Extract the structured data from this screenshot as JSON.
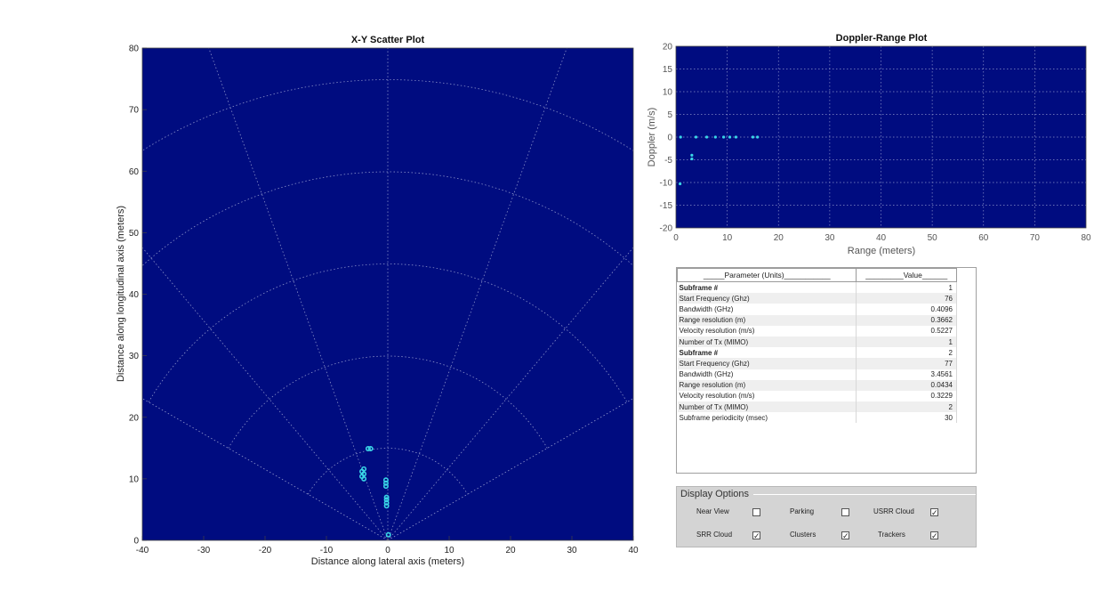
{
  "chart_data": [
    {
      "type": "scatter",
      "title": "X-Y Scatter Plot",
      "xlabel": "Distance along lateral axis (meters)",
      "ylabel": "Distance along longitudinal axis (meters)",
      "xlim": [
        -40,
        40
      ],
      "ylim": [
        0,
        80
      ],
      "xticks": [
        "-40",
        "-30",
        "-20",
        "-10",
        "0",
        "10",
        "20",
        "30",
        "40"
      ],
      "yticks": [
        "0",
        "10",
        "20",
        "30",
        "40",
        "50",
        "60",
        "70",
        "80"
      ],
      "polar_grid": true,
      "background_color": "#000c80",
      "marker_color": "#39d4e6",
      "points": [
        {
          "x": -3.2,
          "y": 14.9
        },
        {
          "x": -2.8,
          "y": 14.9
        },
        {
          "x": -3.9,
          "y": 10.0
        },
        {
          "x": -3.9,
          "y": 10.8
        },
        {
          "x": -3.9,
          "y": 11.6
        },
        {
          "x": -4.2,
          "y": 10.4
        },
        {
          "x": -4.2,
          "y": 11.2
        },
        {
          "x": -0.3,
          "y": 8.8
        },
        {
          "x": -0.3,
          "y": 9.3
        },
        {
          "x": -0.3,
          "y": 9.8
        },
        {
          "x": -0.2,
          "y": 5.6
        },
        {
          "x": -0.2,
          "y": 6.1
        },
        {
          "x": -0.2,
          "y": 6.6
        },
        {
          "x": -0.2,
          "y": 7.0
        },
        {
          "x": 0.1,
          "y": 0.9
        }
      ]
    },
    {
      "type": "scatter",
      "title": "Doppler-Range Plot",
      "xlabel": "Range (meters)",
      "ylabel": "Doppler (m/s)",
      "xlim": [
        0,
        80
      ],
      "ylim": [
        -20,
        20
      ],
      "xticks": [
        "0",
        "10",
        "20",
        "30",
        "40",
        "50",
        "60",
        "70",
        "80"
      ],
      "yticks": [
        "-20",
        "-15",
        "-10",
        "-5",
        "0",
        "5",
        "10",
        "15",
        "20"
      ],
      "grid": true,
      "background_color": "#000c80",
      "marker_color": "#39d4e6",
      "points": [
        {
          "x": 0.9,
          "y": 0
        },
        {
          "x": 3.9,
          "y": 0
        },
        {
          "x": 6.0,
          "y": 0
        },
        {
          "x": 7.7,
          "y": 0
        },
        {
          "x": 9.3,
          "y": 0
        },
        {
          "x": 10.5,
          "y": 0
        },
        {
          "x": 11.7,
          "y": 0
        },
        {
          "x": 15.0,
          "y": 0
        },
        {
          "x": 15.9,
          "y": 0
        },
        {
          "x": 3.1,
          "y": -4.0
        },
        {
          "x": 3.1,
          "y": -4.8
        },
        {
          "x": 0.8,
          "y": -10.3
        }
      ]
    }
  ],
  "parameters": {
    "header_param": "_____Parameter (Units)___________",
    "header_value": "_________Value______",
    "rows": [
      {
        "param": "Subframe #",
        "value": "1",
        "bold": true
      },
      {
        "param": "Start Frequency (Ghz)",
        "value": "76"
      },
      {
        "param": "Bandwidth (GHz)",
        "value": "0.4096"
      },
      {
        "param": "Range resolution (m)",
        "value": "0.3662"
      },
      {
        "param": "Velocity resolution (m/s)",
        "value": "0.5227"
      },
      {
        "param": "Number of Tx (MIMO)",
        "value": "1"
      },
      {
        "param": "Subframe #",
        "value": "2",
        "bold": true
      },
      {
        "param": "Start Frequency (Ghz)",
        "value": "77"
      },
      {
        "param": "Bandwidth (GHz)",
        "value": "3.4561"
      },
      {
        "param": "Range resolution (m)",
        "value": "0.0434"
      },
      {
        "param": "Velocity resolution (m/s)",
        "value": "0.3229"
      },
      {
        "param": "Number of Tx (MIMO)",
        "value": "2"
      },
      {
        "param": "Subframe periodicity (msec)",
        "value": "30"
      }
    ]
  },
  "display_options": {
    "title": "Display Options",
    "options": [
      {
        "label": "Near View",
        "checked": false
      },
      {
        "label": "Parking",
        "checked": false
      },
      {
        "label": "USRR Cloud",
        "checked": true
      },
      {
        "label": "SRR Cloud",
        "checked": true
      },
      {
        "label": "Clusters",
        "checked": true
      },
      {
        "label": "Trackers",
        "checked": true
      }
    ]
  }
}
